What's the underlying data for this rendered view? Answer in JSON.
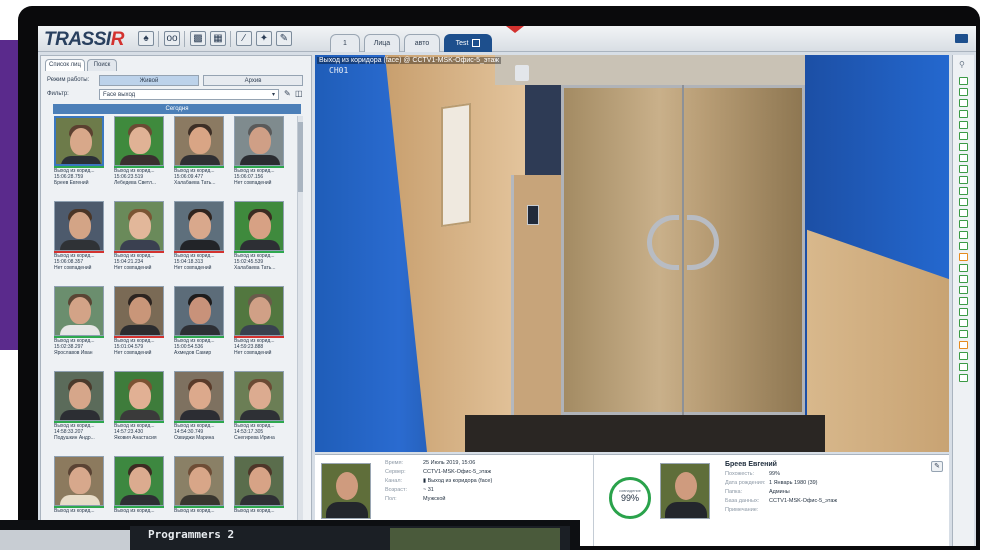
{
  "app": {
    "logo_main": "TRASSI",
    "logo_accent": "R"
  },
  "toolbar": {
    "icons": [
      "bell-icon",
      "oo-icon",
      "monitor-icon",
      "layout-icon",
      "ruler-icon",
      "puzzle-icon",
      "edit-window-icon"
    ],
    "tabs": [
      {
        "label": "1"
      },
      {
        "label": "Лица"
      },
      {
        "label": "авто"
      },
      {
        "label": "Test"
      }
    ]
  },
  "left_panel": {
    "tabs": [
      "Список лиц",
      "Поиск"
    ],
    "mode_label": "Режим работы:",
    "mode_live": "Живой",
    "mode_archive": "Архив",
    "filter_label": "Фильтр:",
    "filter_value": "Face выход",
    "section_title": "Сегодня",
    "cards": [
      {
        "l1": "Выход из корид...",
        "l2": "15:06:28.759",
        "l3": "Бреев Евгений",
        "skin": "#d8a88a",
        "hair": "#5b4030",
        "body": "#2b2f36",
        "bg": "#6d7b4a",
        "bar": "green",
        "selected": true
      },
      {
        "l1": "Выход из корид...",
        "l2": "15:06:23.519",
        "l3": "Лебедева Светл...",
        "skin": "#e0b295",
        "hair": "#6b4a33",
        "body": "#3a2f2f",
        "bg": "#3f8a3d",
        "bar": "green"
      },
      {
        "l1": "Выход из корид...",
        "l2": "15:06:09.477",
        "l3": "Халабаева Тать...",
        "skin": "#d9a585",
        "hair": "#3d2f26",
        "body": "#2f2f33",
        "bg": "#8b7a62",
        "bar": "green"
      },
      {
        "l1": "Выход из корид...",
        "l2": "15:06:07.156",
        "l3": "Нет совпадений",
        "skin": "#cf9f86",
        "hair": "#5a5a5a",
        "body": "#2a2c30",
        "bg": "#7f8b8e",
        "bar": "green"
      },
      {
        "l1": "Выход из корид...",
        "l2": "15:06:08.357",
        "l3": "Нет совпадений",
        "skin": "#d3a486",
        "hair": "#4a3526",
        "body": "#2f3236",
        "bg": "#4d5a6c",
        "bar": "red"
      },
      {
        "l1": "Выход из корид...",
        "l2": "15:04:21.234",
        "l3": "Нет совпадений",
        "skin": "#e2b79a",
        "hair": "#7a5534",
        "body": "#3a4050",
        "bg": "#6a8a5a",
        "bar": "red"
      },
      {
        "l1": "Выход из корид...",
        "l2": "15:04:18.313",
        "l3": "Нет совпадений",
        "skin": "#d9a88c",
        "hair": "#2f241e",
        "body": "#222428",
        "bg": "#5e6f7c",
        "bar": "red"
      },
      {
        "l1": "Выход из корид...",
        "l2": "15:02:45.539",
        "l3": "Халабаева Тать...",
        "skin": "#d7a184",
        "hair": "#3b2b22",
        "body": "#2d2f34",
        "bg": "#3f8a3d",
        "bar": "green"
      },
      {
        "l1": "Выход из корид...",
        "l2": "15:02:38.297",
        "l3": "Ярославов Иван",
        "skin": "#d3a387",
        "hair": "#5a4534",
        "body": "#e6e6e6",
        "bg": "#6b8e6e",
        "bar": "green"
      },
      {
        "l1": "Выход из корид...",
        "l2": "15:01:04.579",
        "l3": "Нет совпадений",
        "skin": "#c99679",
        "hair": "#2c2420",
        "body": "#2b2c2f",
        "bg": "#7a6a55",
        "bar": "red"
      },
      {
        "l1": "Выход из корид...",
        "l2": "15:00:54.536",
        "l3": "Ахмедов Самир",
        "skin": "#c8927a",
        "hair": "#1e1c1c",
        "body": "#2d2f34",
        "bg": "#5c6c79",
        "bar": "green"
      },
      {
        "l1": "Выход из корид...",
        "l2": "14:59:23.888",
        "l3": "Нет совпадений",
        "skin": "#d0a086",
        "hair": "#6a5a4a",
        "body": "#38414f",
        "bg": "#52773f",
        "bar": "red"
      },
      {
        "l1": "Выход из корид...",
        "l2": "14:58:33.207",
        "l3": "Подушкин Андр...",
        "skin": "#d6a68a",
        "hair": "#4b3a2c",
        "body": "#2c2e33",
        "bg": "#5b6b5a",
        "bar": "green"
      },
      {
        "l1": "Выход из корид...",
        "l2": "14:57:23.430",
        "l3": "Яковия Анастасия",
        "skin": "#e1b094",
        "hair": "#7b5233",
        "body": "#3a3a3a",
        "bg": "#3e7c3b",
        "bar": "green"
      },
      {
        "l1": "Выход из корид...",
        "l2": "14:54:30.749",
        "l3": "Озвиджи Марина",
        "skin": "#dca98c",
        "hair": "#5a3b2a",
        "body": "#2c2d33",
        "bg": "#7e7160",
        "bar": "green"
      },
      {
        "l1": "Выход из корид...",
        "l2": "14:53:17.305",
        "l3": "Снегирева Ирина",
        "skin": "#dcab90",
        "hair": "#6b4a34",
        "body": "#2e3035",
        "bg": "#6b7e55",
        "bar": "green"
      },
      {
        "l1": "Выход из корид...",
        "l2": "",
        "l3": "",
        "skin": "#d7a88c",
        "hair": "#5a4334",
        "body": "#e8dcc8",
        "bg": "#8c7a5e",
        "bar": "green"
      },
      {
        "l1": "Выход из корид...",
        "l2": "",
        "l3": "",
        "skin": "#dbab8f",
        "hair": "#3c2b22",
        "body": "#2d2e33",
        "bg": "#3d8840",
        "bar": "green"
      },
      {
        "l1": "Выход из корид...",
        "l2": "",
        "l3": "",
        "skin": "#d8a688",
        "hair": "#6e4d36",
        "body": "#39362f",
        "bg": "#8a8066",
        "bar": "green"
      },
      {
        "l1": "Выход из корид...",
        "l2": "",
        "l3": "",
        "skin": "#d7a386",
        "hair": "#4e3629",
        "body": "#2e2f34",
        "bg": "#5a6d4c",
        "bar": "green"
      }
    ]
  },
  "video": {
    "caption": "Выход из коридора (face) @ CCTV1-MSK-Офис-5_этаж",
    "channel": "CH01"
  },
  "event": {
    "time_label": "Время:",
    "time_value": "25 Июль 2019, 15:06",
    "server_label": "Сервер:",
    "server_value": "CCTV1-MSK-Офис-5_этаж",
    "camera_label": "Канал:",
    "camera_value": "Выход из коридора (face)",
    "age_label": "Возраст:",
    "age_value": "~ 31",
    "gender_label": "Пол:",
    "gender_value": "Мужской"
  },
  "match": {
    "caption": "совпадение",
    "percent": "99%",
    "name": "Бреев Евгений",
    "similarity_label": "Похожесть:",
    "similarity_value": "99%",
    "birth_label": "Дата рождения:",
    "birth_value": "1 Январь 1980 (39)",
    "folder_label": "Папка:",
    "folder_value": "Админы",
    "db_label": "База данных:",
    "db_value": "CCTV1-MSK-Офис-5_этаж",
    "note_label": "Примечание:"
  },
  "strip_icons": [
    "g",
    "g",
    "g",
    "g",
    "g",
    "g",
    "g",
    "g",
    "g",
    "g",
    "g",
    "g",
    "g",
    "g",
    "g",
    "g",
    "o",
    "g",
    "g",
    "g",
    "g",
    "g",
    "g",
    "g",
    "o",
    "g",
    "g",
    "g"
  ],
  "second_monitor": {
    "title": "Programmers 2"
  }
}
